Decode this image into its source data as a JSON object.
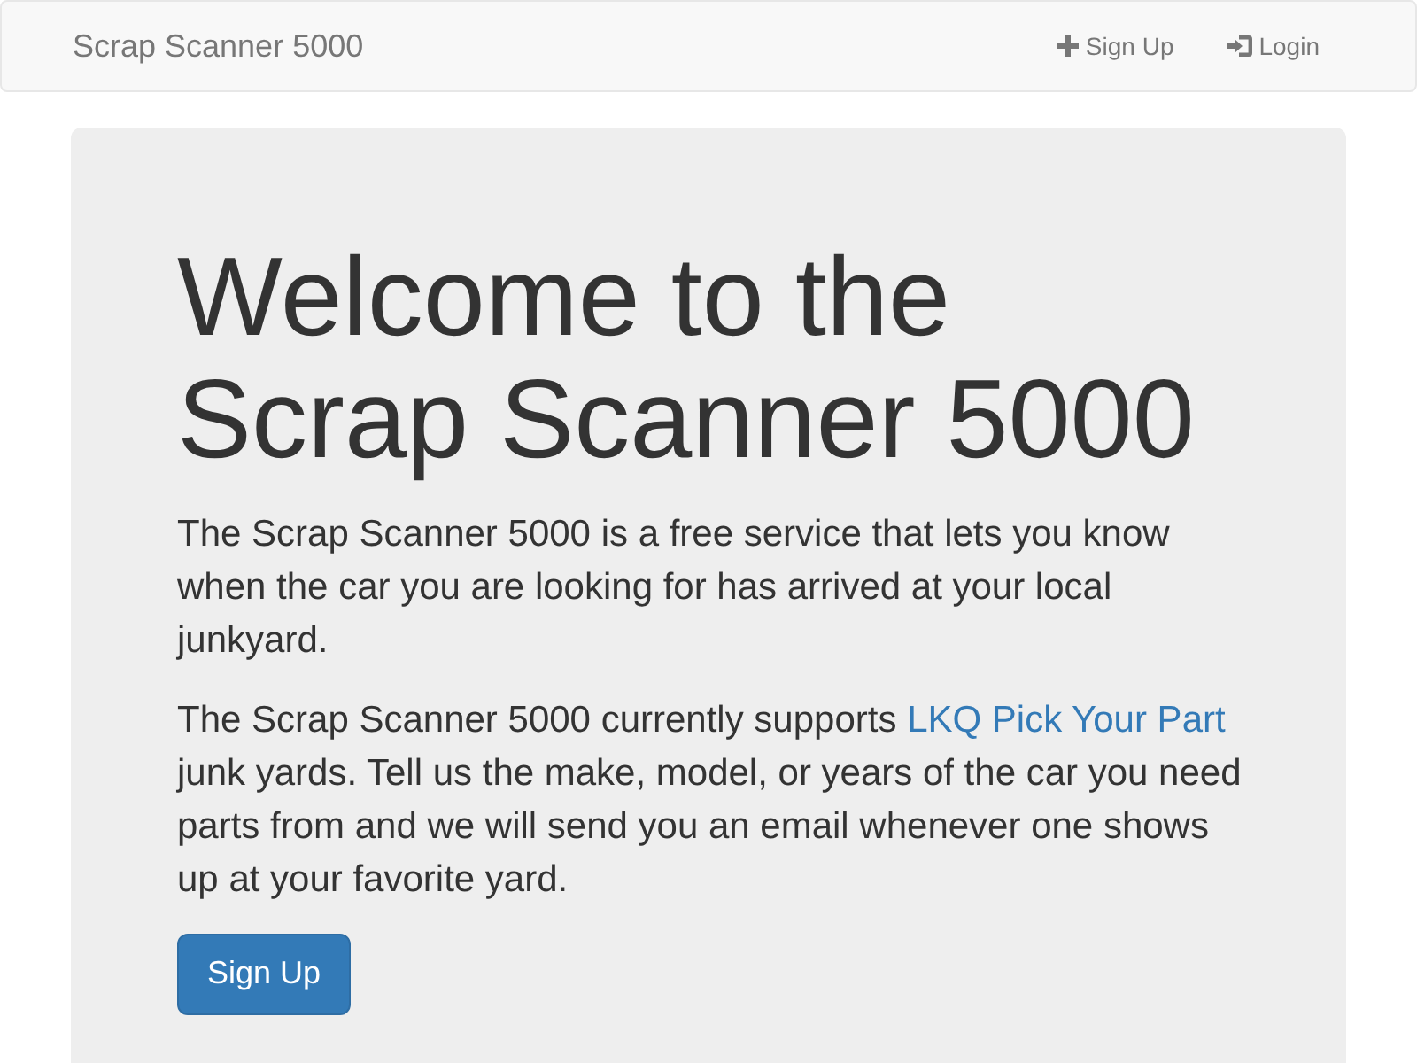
{
  "navbar": {
    "brand": "Scrap Scanner 5000",
    "links": [
      {
        "label": "Sign Up",
        "kind": "plus"
      },
      {
        "label": "Login",
        "kind": "login"
      }
    ]
  },
  "hero": {
    "heading": "Welcome to the Scrap Scanner 5000",
    "paragraphs": [
      {
        "text": "The Scrap Scanner 5000 is a free service that lets you know when the car you are looking for has arrived at your local junkyard."
      },
      {
        "text": "The Scrap Scanner 5000 currently supports ",
        "link": "LKQ Pick Your Part",
        "after": " junk yards. Tell us the make, model, or years of the car you need parts from and we will send you an email whenever one shows up at your favorite yard."
      }
    ],
    "button": "Sign Up"
  }
}
